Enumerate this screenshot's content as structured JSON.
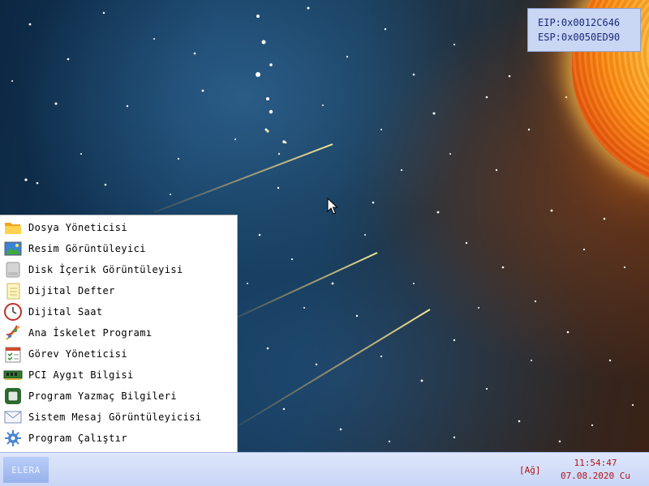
{
  "registers": {
    "eip": "EIP:0x0012C646",
    "esp": "ESP:0x0050ED90"
  },
  "start_menu": {
    "items": [
      {
        "label": "Dosya Yöneticisi",
        "icon": "folder-icon"
      },
      {
        "label": "Resim Görüntüleyici",
        "icon": "image-icon"
      },
      {
        "label": "Disk İçerik Görüntüleyisi",
        "icon": "disk-icon"
      },
      {
        "label": "Dijital Defter",
        "icon": "notepad-icon"
      },
      {
        "label": "Dijital Saat",
        "icon": "clock-icon"
      },
      {
        "label": "Ana İskelet Programı",
        "icon": "dna-icon"
      },
      {
        "label": "Görev Yöneticisi",
        "icon": "calendar-checklist-icon"
      },
      {
        "label": "PCI Aygıt Bilgisi",
        "icon": "pci-card-icon"
      },
      {
        "label": "Program Yazmaç Bilgileri",
        "icon": "chip-icon"
      },
      {
        "label": "Sistem Mesaj Görüntüleyicisi",
        "icon": "envelope-icon"
      },
      {
        "label": "Program Çalıştır",
        "icon": "gear-icon"
      }
    ]
  },
  "taskbar": {
    "start_label": "ELERA",
    "network": "[Ağ]",
    "time": "11:54:47",
    "date": "07.08.2020 Cu"
  },
  "colors": {
    "taskbar_bg": "#c9d6f6",
    "start_button": "#98b2ec",
    "register_panel": "#c9d6f4",
    "status_text": "#b0151a"
  }
}
